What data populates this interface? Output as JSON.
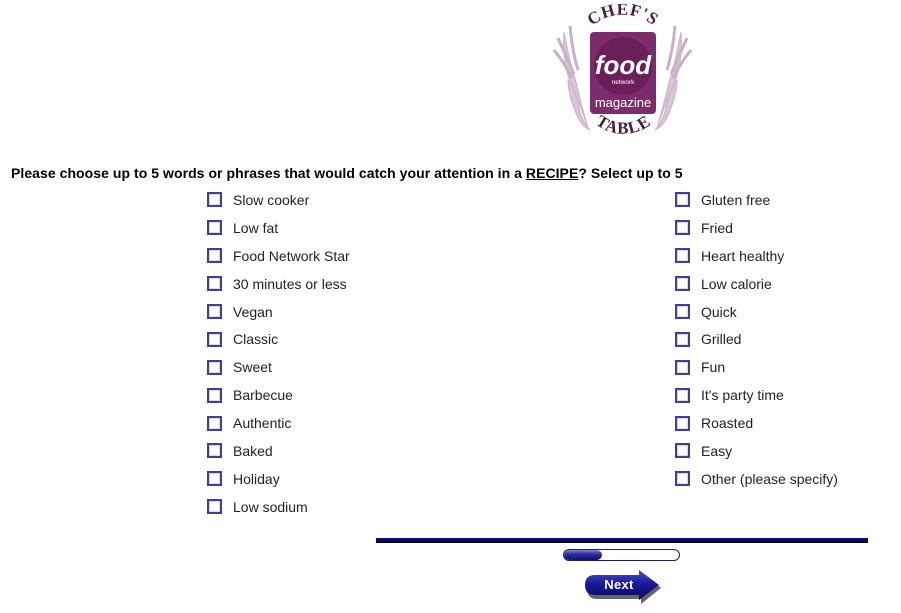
{
  "logo": {
    "top_text": "CHEF'S",
    "brand": "food",
    "brand_sub": "network",
    "brand_line2": "magazine",
    "bottom_text": "TABLE",
    "brand_color": "#7d2c6b",
    "accent_color": "#d6c3d4",
    "text_color": "#4a1a3e"
  },
  "question": {
    "prefix": "Please choose up to 5 words or phrases that would catch your attention in a ",
    "emphasis": "RECIPE",
    "suffix": "? Select up to 5"
  },
  "options": {
    "left": [
      {
        "label": "Slow cooker",
        "checked": false
      },
      {
        "label": "Low fat",
        "checked": false
      },
      {
        "label": "Food Network Star",
        "checked": false
      },
      {
        "label": "30 minutes or less",
        "checked": false
      },
      {
        "label": "Vegan",
        "checked": false
      },
      {
        "label": "Classic",
        "checked": false
      },
      {
        "label": "Sweet",
        "checked": false
      },
      {
        "label": "Barbecue",
        "checked": false
      },
      {
        "label": "Authentic",
        "checked": false
      },
      {
        "label": "Baked",
        "checked": false
      },
      {
        "label": "Holiday",
        "checked": false
      },
      {
        "label": "Low sodium",
        "checked": false
      }
    ],
    "right": [
      {
        "label": "Gluten free",
        "checked": false
      },
      {
        "label": "Fried",
        "checked": false
      },
      {
        "label": "Heart healthy",
        "checked": false
      },
      {
        "label": "Low calorie",
        "checked": false
      },
      {
        "label": "Quick",
        "checked": false
      },
      {
        "label": "Grilled",
        "checked": false
      },
      {
        "label": "Fun",
        "checked": false
      },
      {
        "label": "It's party time",
        "checked": false
      },
      {
        "label": "Roasted",
        "checked": false
      },
      {
        "label": "Easy",
        "checked": false
      },
      {
        "label": "Other (please specify)",
        "checked": false
      }
    ]
  },
  "progress": {
    "percent": 33
  },
  "navigation": {
    "next_label": "Next"
  },
  "colors": {
    "nav_blue": "#12127a",
    "checkbox_border": "#3d3fa0"
  }
}
